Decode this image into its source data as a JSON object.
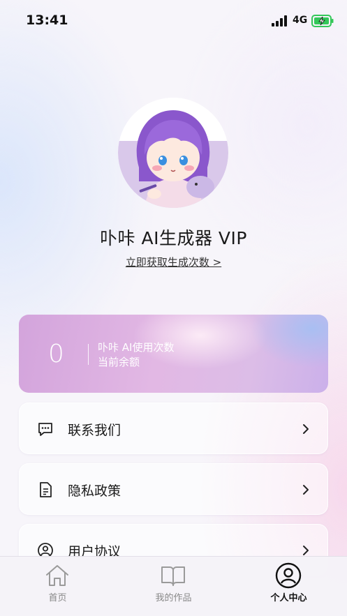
{
  "status_bar": {
    "time": "13:41",
    "network": "4G"
  },
  "profile": {
    "title": "卟咔 AI生成器 VIP",
    "get_link": "立即获取生成次数 >"
  },
  "balance": {
    "value": "0",
    "label_line1": "卟咔 AI使用次数",
    "label_line2": "当前余额"
  },
  "menu": [
    {
      "label": "联系我们",
      "icon": "chat-icon"
    },
    {
      "label": "隐私政策",
      "icon": "document-icon"
    },
    {
      "label": "用户协议",
      "icon": "user-icon"
    }
  ],
  "tabs": [
    {
      "label": "首页",
      "icon": "home-icon",
      "active": false
    },
    {
      "label": "我的作品",
      "icon": "book-icon",
      "active": false
    },
    {
      "label": "个人中心",
      "icon": "user-circle-icon",
      "active": true
    }
  ],
  "colors": {
    "accent_card": "#d3a4dc",
    "battery": "#34c759"
  }
}
